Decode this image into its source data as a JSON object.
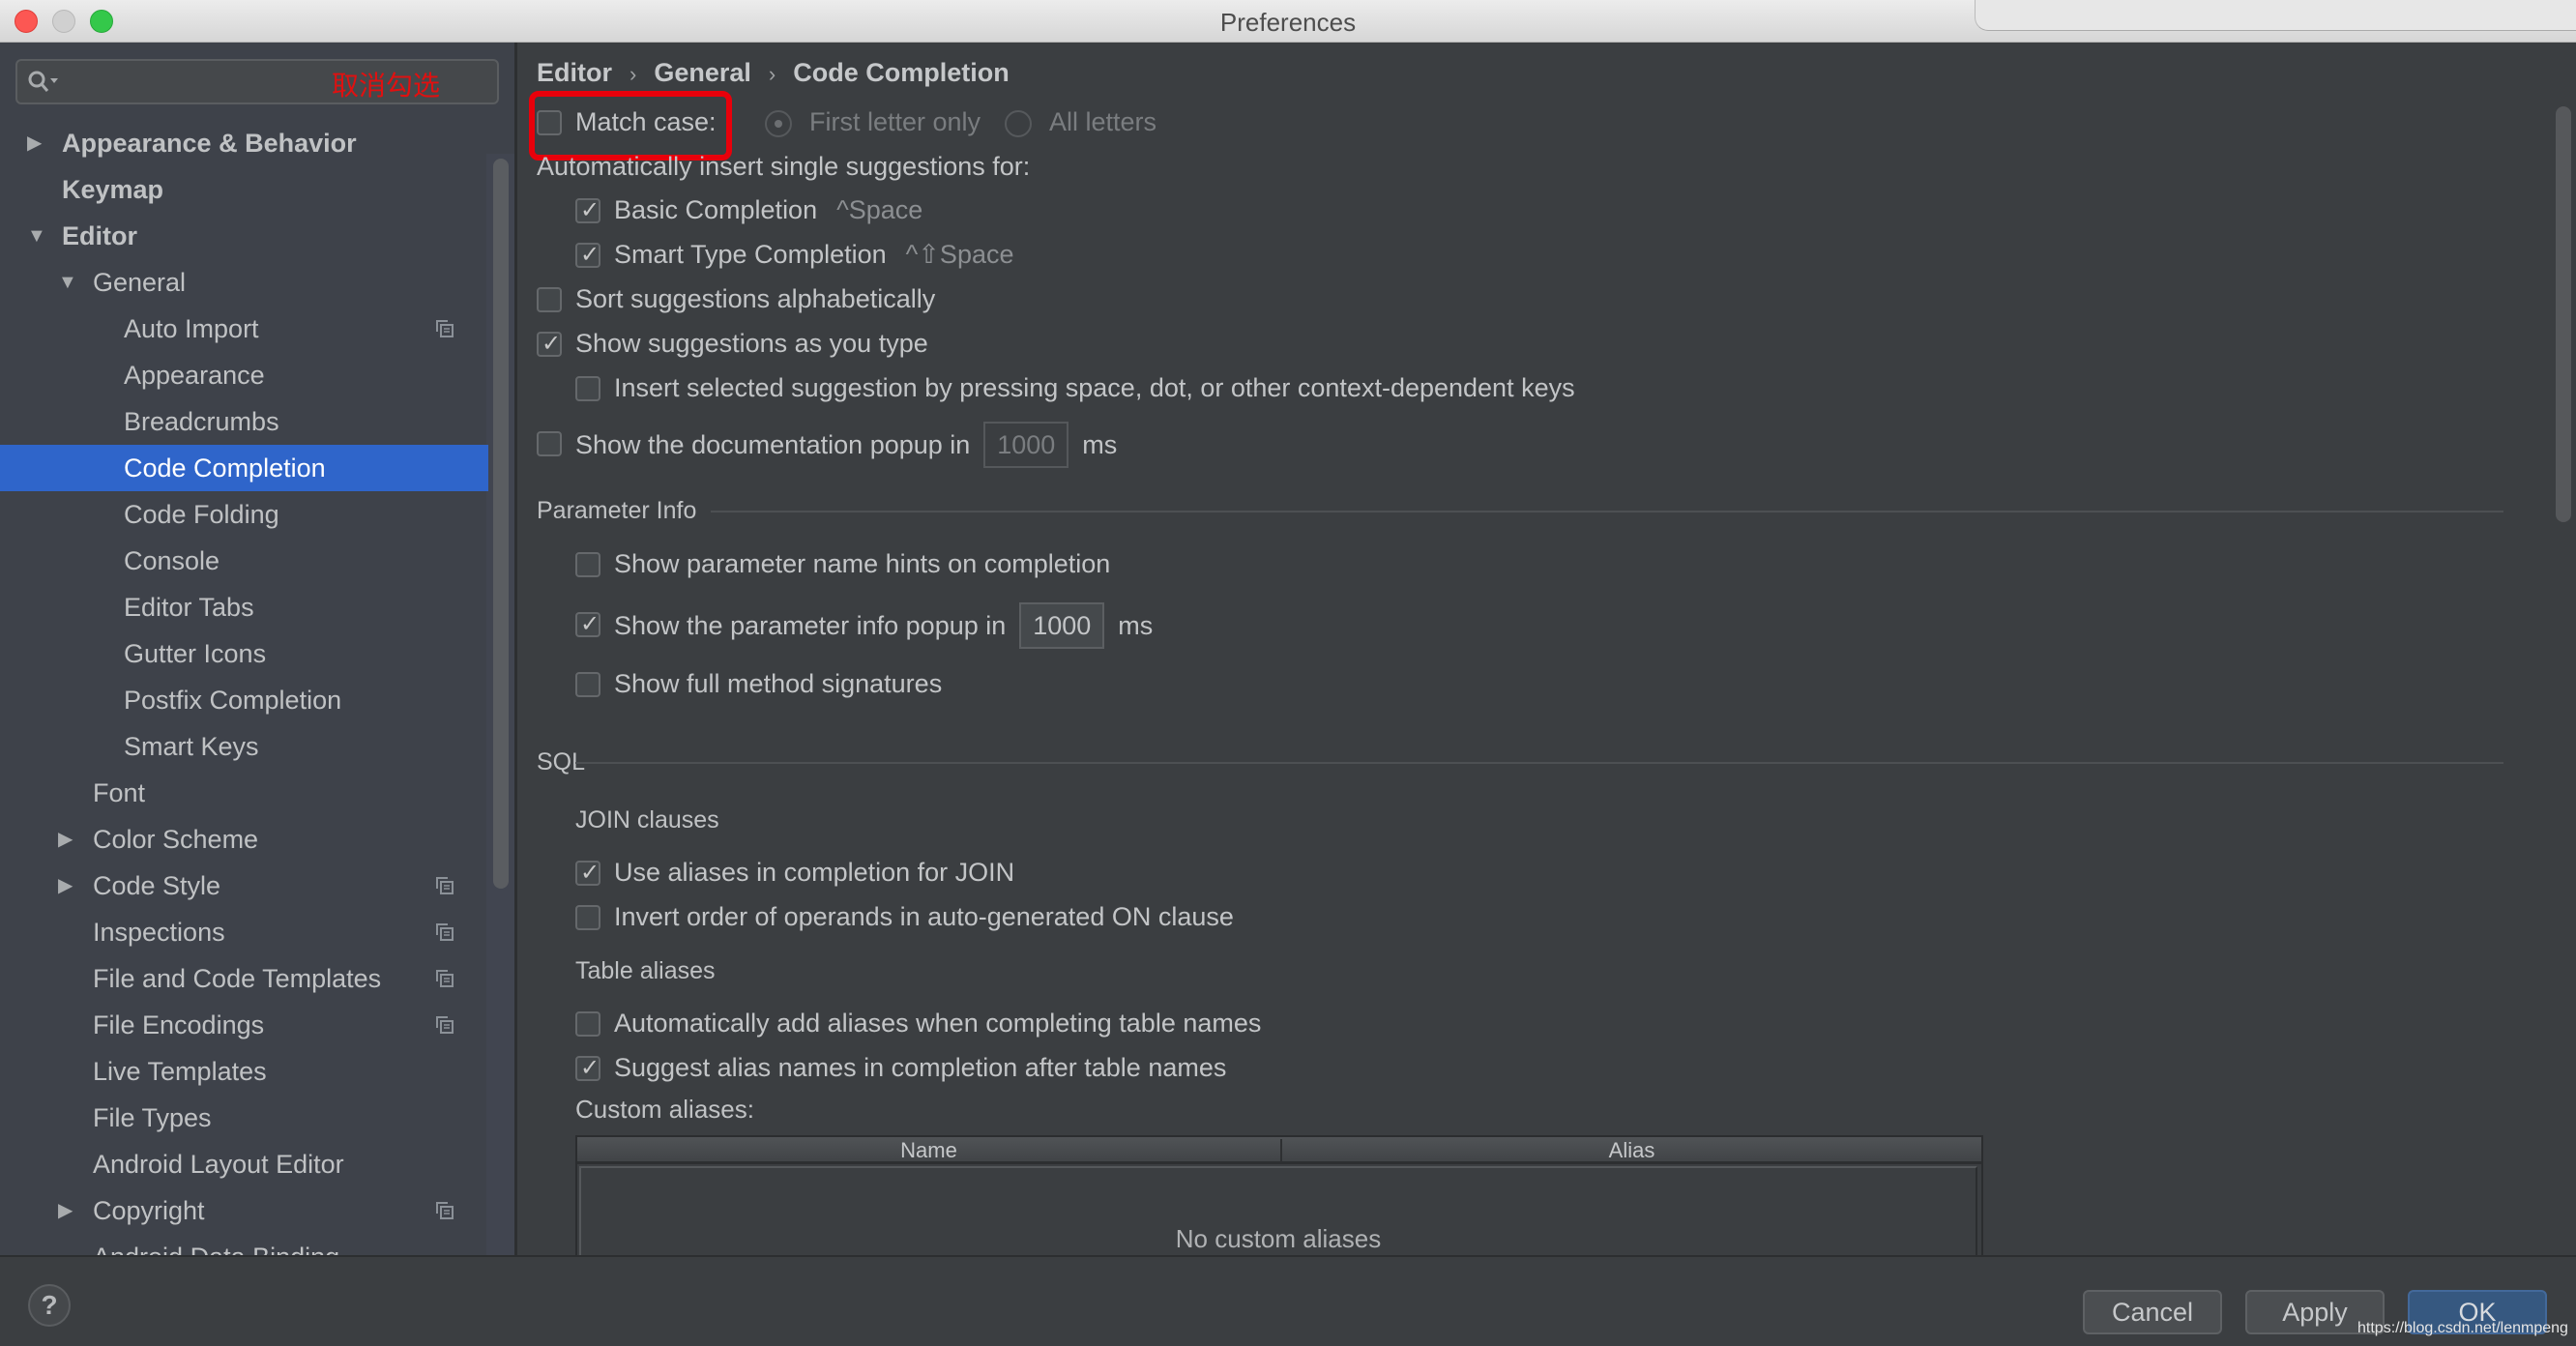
{
  "window": {
    "title": "Preferences"
  },
  "sidebar": {
    "search": {
      "value": "",
      "annotation": "取消勾选"
    },
    "items": [
      {
        "label": "Appearance & Behavior",
        "level": 0,
        "arrow": "right",
        "bold": true,
        "project_icon": false,
        "selected": false
      },
      {
        "label": "Keymap",
        "level": 0,
        "arrow": "",
        "bold": true,
        "project_icon": false,
        "selected": false
      },
      {
        "label": "Editor",
        "level": 0,
        "arrow": "down",
        "bold": true,
        "project_icon": false,
        "selected": false
      },
      {
        "label": "General",
        "level": 1,
        "arrow": "down",
        "bold": false,
        "project_icon": false,
        "selected": false
      },
      {
        "label": "Auto Import",
        "level": 2,
        "arrow": "",
        "bold": false,
        "project_icon": true,
        "selected": false
      },
      {
        "label": "Appearance",
        "level": 2,
        "arrow": "",
        "bold": false,
        "project_icon": false,
        "selected": false
      },
      {
        "label": "Breadcrumbs",
        "level": 2,
        "arrow": "",
        "bold": false,
        "project_icon": false,
        "selected": false
      },
      {
        "label": "Code Completion",
        "level": 2,
        "arrow": "",
        "bold": false,
        "project_icon": false,
        "selected": true
      },
      {
        "label": "Code Folding",
        "level": 2,
        "arrow": "",
        "bold": false,
        "project_icon": false,
        "selected": false
      },
      {
        "label": "Console",
        "level": 2,
        "arrow": "",
        "bold": false,
        "project_icon": false,
        "selected": false
      },
      {
        "label": "Editor Tabs",
        "level": 2,
        "arrow": "",
        "bold": false,
        "project_icon": false,
        "selected": false
      },
      {
        "label": "Gutter Icons",
        "level": 2,
        "arrow": "",
        "bold": false,
        "project_icon": false,
        "selected": false
      },
      {
        "label": "Postfix Completion",
        "level": 2,
        "arrow": "",
        "bold": false,
        "project_icon": false,
        "selected": false
      },
      {
        "label": "Smart Keys",
        "level": 2,
        "arrow": "",
        "bold": false,
        "project_icon": false,
        "selected": false
      },
      {
        "label": "Font",
        "level": 1,
        "arrow": "",
        "bold": false,
        "project_icon": false,
        "selected": false
      },
      {
        "label": "Color Scheme",
        "level": 1,
        "arrow": "right",
        "bold": false,
        "project_icon": false,
        "selected": false
      },
      {
        "label": "Code Style",
        "level": 1,
        "arrow": "right",
        "bold": false,
        "project_icon": true,
        "selected": false
      },
      {
        "label": "Inspections",
        "level": 1,
        "arrow": "",
        "bold": false,
        "project_icon": true,
        "selected": false
      },
      {
        "label": "File and Code Templates",
        "level": 1,
        "arrow": "",
        "bold": false,
        "project_icon": true,
        "selected": false
      },
      {
        "label": "File Encodings",
        "level": 1,
        "arrow": "",
        "bold": false,
        "project_icon": true,
        "selected": false
      },
      {
        "label": "Live Templates",
        "level": 1,
        "arrow": "",
        "bold": false,
        "project_icon": false,
        "selected": false
      },
      {
        "label": "File Types",
        "level": 1,
        "arrow": "",
        "bold": false,
        "project_icon": false,
        "selected": false
      },
      {
        "label": "Android Layout Editor",
        "level": 1,
        "arrow": "",
        "bold": false,
        "project_icon": false,
        "selected": false
      },
      {
        "label": "Copyright",
        "level": 1,
        "arrow": "right",
        "bold": false,
        "project_icon": true,
        "selected": false
      },
      {
        "label": "Android Data Binding",
        "level": 1,
        "arrow": "",
        "bold": false,
        "project_icon": false,
        "selected": false
      }
    ]
  },
  "main": {
    "breadcrumb": [
      "Editor",
      "General",
      "Code Completion"
    ],
    "match_case": {
      "label": "Match case:",
      "checked": false,
      "options": [
        {
          "label": "First letter only",
          "selected": true
        },
        {
          "label": "All letters",
          "selected": false
        }
      ]
    },
    "auto_insert_label": "Automatically insert single suggestions for:",
    "basic_completion": {
      "label": "Basic Completion",
      "shortcut": "^Space",
      "checked": true
    },
    "smart_type_completion": {
      "label": "Smart Type Completion",
      "shortcut": "^⇧Space",
      "checked": true
    },
    "sort_alphabetically": {
      "label": "Sort suggestions alphabetically",
      "checked": false
    },
    "show_as_you_type": {
      "label": "Show suggestions as you type",
      "checked": true
    },
    "insert_selected": {
      "label": "Insert selected suggestion by pressing space, dot, or other context-dependent keys",
      "checked": false
    },
    "doc_popup": {
      "label": "Show the documentation popup in",
      "value": "1000",
      "unit": "ms",
      "checked": false
    },
    "parameter_info": {
      "title": "Parameter Info",
      "name_hints": {
        "label": "Show parameter name hints on completion",
        "checked": false
      },
      "info_popup": {
        "label": "Show the parameter info popup in",
        "value": "1000",
        "unit": "ms",
        "checked": true
      },
      "full_signatures": {
        "label": "Show full method signatures",
        "checked": false
      }
    },
    "sql": {
      "title": "SQL",
      "join_title": "JOIN clauses",
      "use_aliases_join": {
        "label": "Use aliases in completion for JOIN",
        "checked": true
      },
      "invert_operands": {
        "label": "Invert order of operands in auto-generated ON clause",
        "checked": false
      },
      "table_aliases_title": "Table aliases",
      "auto_add_aliases": {
        "label": "Automatically add aliases when completing table names",
        "checked": false
      },
      "suggest_alias_names": {
        "label": "Suggest alias names in completion after table names",
        "checked": true
      },
      "custom_aliases_label": "Custom aliases:",
      "table": {
        "columns": [
          "Name",
          "Alias"
        ],
        "rows": [],
        "empty_text": "No custom aliases"
      }
    }
  },
  "footer": {
    "help_label": "?",
    "cancel_label": "Cancel",
    "apply_label": "Apply",
    "ok_label": "OK",
    "watermark": "https://blog.csdn.net/lenmpeng"
  },
  "colors": {
    "accent_selection": "#2f65ca",
    "annotation_red": "#e8000b",
    "ok_button": "#365880"
  }
}
